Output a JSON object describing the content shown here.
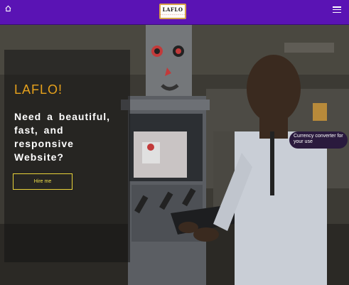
{
  "nav": {
    "logo_text": "LAFLO",
    "logo_subtext": "~~~~~~~~~~~~~~~~~",
    "icons": {
      "home": "home-icon",
      "menu": "hamburger-menu-icon"
    },
    "background_color": "#5a13b4"
  },
  "hero": {
    "brand": "LAFLO!",
    "headline": "Need a beautiful, fast, and responsive Website?",
    "cta_label": "Hire me",
    "accent_color": "#e6a11c",
    "button_color": "#e8d23a"
  },
  "floating": {
    "currency_label": "Currency converter for your use"
  }
}
